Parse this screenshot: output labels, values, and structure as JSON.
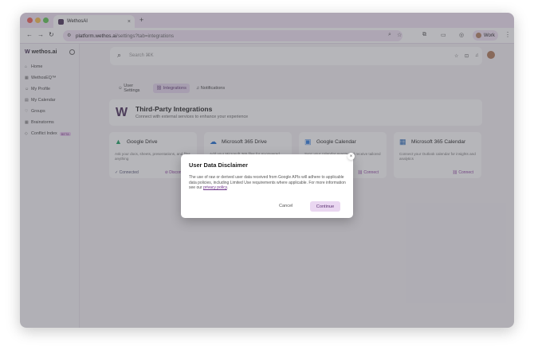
{
  "browser": {
    "tab_title": "WethosAI",
    "tab_close": "×",
    "new_tab": "+",
    "url_host": "platform.wethos.ai",
    "url_path": "/settings?tab=integrations",
    "profile_label": "Work"
  },
  "sidebar": {
    "logo_text": "wethos.ai",
    "items": [
      {
        "label": "Home",
        "icon": "home-icon"
      },
      {
        "label": "WethosEQ™",
        "icon": "grid-icon"
      },
      {
        "label": "My Profile",
        "icon": "user-icon"
      },
      {
        "label": "My Calendar",
        "icon": "calendar-icon"
      },
      {
        "label": "Groups",
        "icon": "heart-icon"
      },
      {
        "label": "Brainstorms",
        "icon": "grid-icon"
      },
      {
        "label": "Conflict Index",
        "icon": "shield-icon",
        "badge": "BETA"
      }
    ]
  },
  "header": {
    "search_placeholder": "Search  ⌘K"
  },
  "settings_tabs": [
    {
      "label": "User Settings",
      "active": false
    },
    {
      "label": "Integrations",
      "active": true
    },
    {
      "label": "Notifications",
      "active": false
    }
  ],
  "hero": {
    "title": "Third-Party Integrations",
    "subtitle": "Connect with external services to enhance your experience"
  },
  "integrations": [
    {
      "name": "Google Drive",
      "description": "Ask your docs, sheets, presentations, and files anything",
      "status": "✓ Connected",
      "action": "⊘ Disconnect"
    },
    {
      "name": "Microsoft 365 Drive",
      "description": "Add your Microsoft 365 files for AI-powered insights",
      "status": "",
      "action": ""
    },
    {
      "name": "Google Calendar",
      "description": "Sync your calendar events and receive tailored insights",
      "status": "",
      "action": "⛓ Connect"
    },
    {
      "name": "Microsoft 365 Calendar",
      "description": "Connect your Outlook calendar for insights and analytics",
      "status": "",
      "action": "⛓ Connect"
    }
  ],
  "modal": {
    "title": "User Data Disclaimer",
    "body": "The use of raw or derived user data received from Google APIs will adhere to applicable data policies, including Limited Use requirements where applicable. For more information see our",
    "link_text": "privacy policy",
    "body_end": ".",
    "cancel_label": "Cancel",
    "continue_label": "Continue",
    "close": "×"
  },
  "colors": {
    "accent": "#8b3ba0",
    "tab_strip": "#f1e3f4",
    "continue_bg": "#ead7f1"
  }
}
